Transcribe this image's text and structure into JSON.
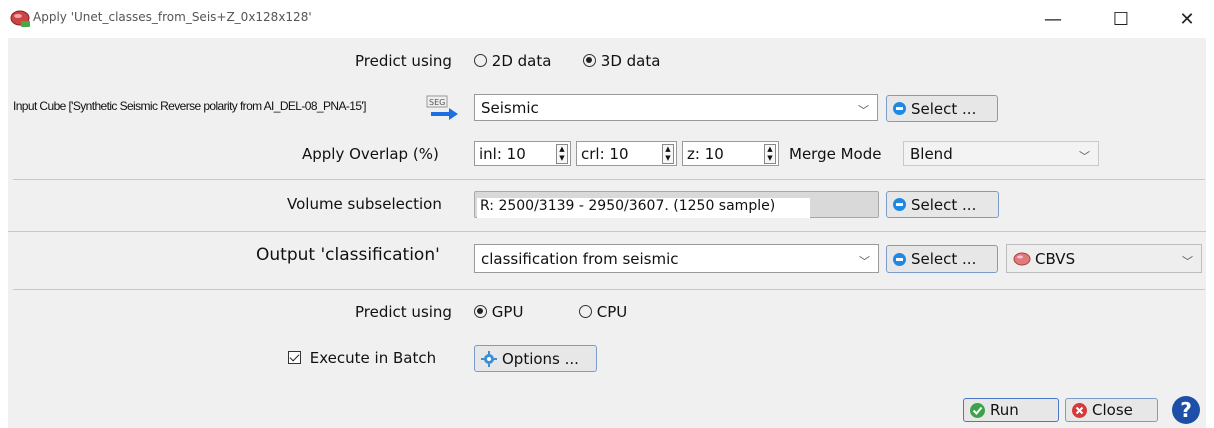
{
  "window": {
    "title": "Apply 'Unet_classes_from_Seis+Z_0x128x128'",
    "minimize": "—",
    "maximize": "☐",
    "close": "✕"
  },
  "predict_data": {
    "label": "Predict using",
    "options": [
      "2D data",
      "3D data"
    ],
    "selected": "3D data"
  },
  "input": {
    "label": "Input Cube ['Synthetic Seismic Reverse polarity from AI_DEL-08_PNA-15']",
    "segy_icon_text": "SEG",
    "value": "Seismic",
    "select_label": "Select ..."
  },
  "overlap": {
    "label": "Apply Overlap (%)",
    "inl": "inl: 10",
    "crl": "crl: 10",
    "z": "z: 10",
    "merge_label": "Merge Mode",
    "merge_value": "Blend"
  },
  "subsel": {
    "label": "Volume subselection",
    "value": "R: 2500/3139 - 2950/3607.  (1250 sample)",
    "select_label": "Select ..."
  },
  "output": {
    "label": "Output 'classification'",
    "value": "classification from seismic",
    "select_label": "Select ...",
    "format": "CBVS"
  },
  "predict_device": {
    "label": "Predict using",
    "options": [
      "GPU",
      "CPU"
    ],
    "selected": "GPU"
  },
  "batch": {
    "label": "Execute in Batch",
    "checked": true,
    "options_label": "Options ..."
  },
  "footer": {
    "run": "Run",
    "close": "Close",
    "help": "?"
  },
  "colors": {
    "accent": "#1e88e5",
    "run_green": "#3aa34a",
    "close_red": "#d9383a"
  }
}
